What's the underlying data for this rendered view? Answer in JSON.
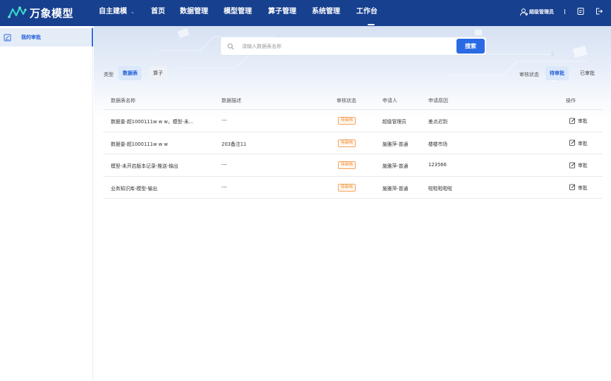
{
  "app": {
    "logo_text": "万象模型",
    "nav": [
      {
        "label": "自主建模",
        "has_dropdown": true
      },
      {
        "label": "首页"
      },
      {
        "label": "数据管理"
      },
      {
        "label": "模型管理"
      },
      {
        "label": "算子管理"
      },
      {
        "label": "系统管理"
      },
      {
        "label": "工作台",
        "active": true
      }
    ],
    "user_name": "超级管理员",
    "icons": {
      "user": "user-icon",
      "doc": "document-icon",
      "logout": "logout-icon"
    }
  },
  "sidebar": {
    "items": [
      {
        "label": "我的审批",
        "icon": "approval-icon",
        "active": true
      }
    ]
  },
  "search": {
    "placeholder": "请输入数据表名称",
    "button_label": "搜索"
  },
  "filters": {
    "type_label": "类型",
    "type_options": [
      "数据表",
      "算子"
    ],
    "type_selected": "数据表",
    "status_label": "审核状态",
    "status_options": [
      "待审批",
      "已审批"
    ],
    "status_selected": "待审批"
  },
  "table": {
    "columns": [
      "数据表名称",
      "数据描述",
      "审核状态",
      "申请人",
      "申请原因",
      "操作"
    ],
    "rows": [
      {
        "name": "数据量-超1000111w w w，模型-未...",
        "desc": "---",
        "status": "待审核",
        "applicant": "超级管理员",
        "reason": "差点迟到",
        "action": "审批"
      },
      {
        "name": "数据量-超1000111w w w",
        "desc": "203备注11",
        "status": "待审核",
        "applicant": "施雅萍-普通",
        "reason": "楼楼市场",
        "action": "审批"
      },
      {
        "name": "模型-未开启版本记录-推送-输出",
        "desc": "---",
        "status": "待审核",
        "applicant": "施雅萍-普通",
        "reason": "123566",
        "action": "审批"
      },
      {
        "name": "业务知识库-模型-输出",
        "desc": "---",
        "status": "待审核",
        "applicant": "施雅萍-普通",
        "reason": "啦啦啦啦啦",
        "action": "审批"
      }
    ]
  },
  "colors": {
    "nav_bg": "#17408f",
    "accent": "#2a6ae4",
    "badge": "#f08a2c"
  }
}
